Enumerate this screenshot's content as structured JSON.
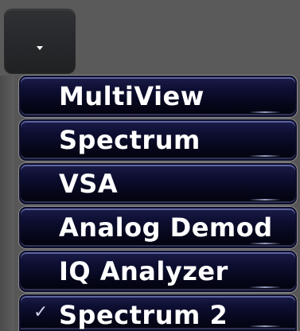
{
  "dropdown": {
    "icon": "triangle-down-icon"
  },
  "menu": {
    "items": [
      {
        "label": "MultiView",
        "selected": false
      },
      {
        "label": "Spectrum",
        "selected": false
      },
      {
        "label": "VSA",
        "selected": false
      },
      {
        "label": "Analog Demod",
        "selected": false
      },
      {
        "label": "IQ Analyzer",
        "selected": false
      },
      {
        "label": "Spectrum 2",
        "selected": true,
        "checkmark": "✓"
      }
    ]
  },
  "colors": {
    "background": "#575757",
    "item_gradient_top": "#1c1d4a",
    "item_gradient_bottom": "#03030f",
    "item_text": "#ffffff"
  }
}
